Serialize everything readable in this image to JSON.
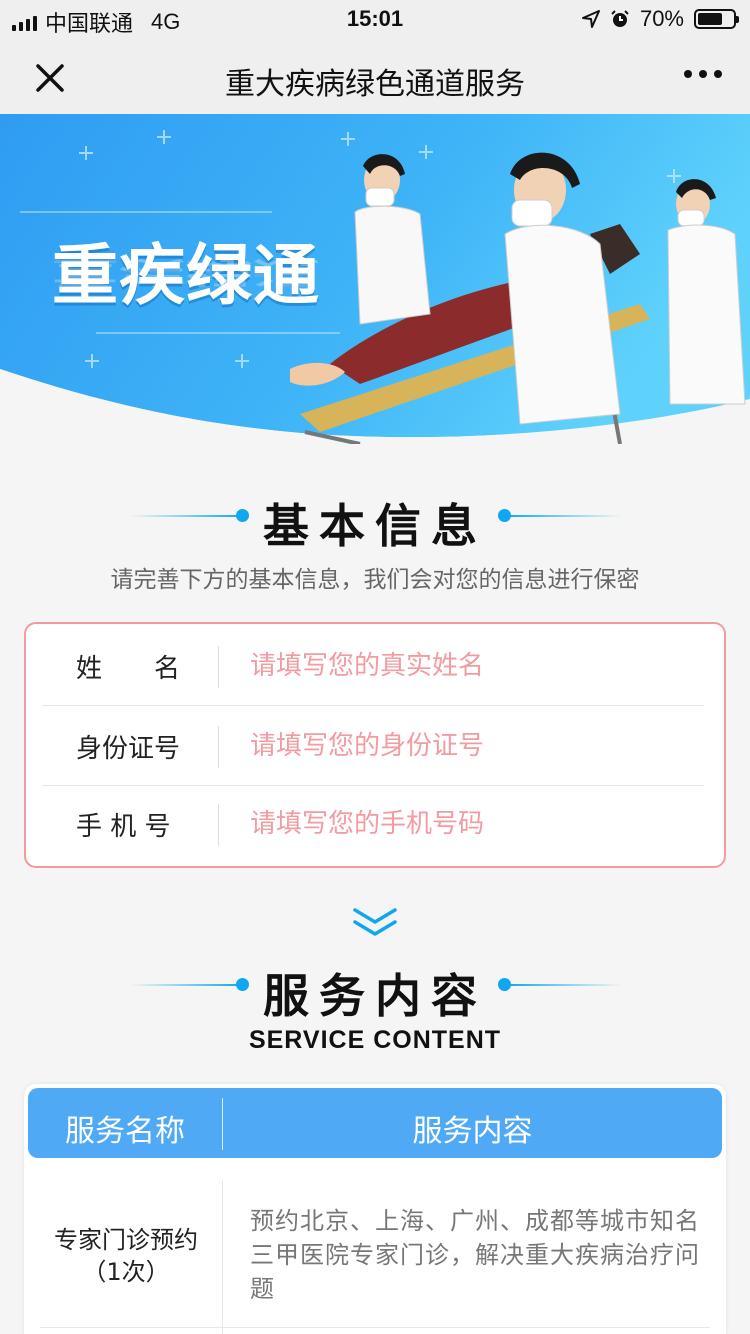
{
  "status_bar": {
    "carrier": "中国联通",
    "network": "4G",
    "time": "15:01",
    "battery": "70%",
    "battery_level": 0.7
  },
  "nav": {
    "title": "重大疾病绿色通道服务",
    "close_icon": "close-icon",
    "more_icon": "more-dots-icon"
  },
  "banner": {
    "title": "重疾绿通"
  },
  "basic_info": {
    "title": "基本信息",
    "subtitle": "请完善下方的基本信息，我们会对您的信息进行保密",
    "fields": [
      {
        "label": "姓　　名",
        "placeholder": "请填写您的真实姓名",
        "value": ""
      },
      {
        "label": "身份证号",
        "placeholder": "请填写您的身份证号",
        "value": ""
      },
      {
        "label": "手 机 号",
        "placeholder": "请填写您的手机号码",
        "value": ""
      }
    ]
  },
  "service": {
    "title": "服务内容",
    "title_en": "SERVICE CONTENT",
    "table_headers": [
      "服务名称",
      "服务内容"
    ],
    "rows": [
      {
        "name_line1": "专家门诊预约",
        "name_line2": "（1次）",
        "content": "预约北京、上海、广州、成都等城市知名三甲医院专家门诊，解决重大疾病治疗问题"
      }
    ]
  },
  "colors": {
    "accent_blue": "#10a7ef",
    "table_header": "#4fa9f4",
    "form_border": "#f29a9e",
    "placeholder": "#f29ba0"
  }
}
